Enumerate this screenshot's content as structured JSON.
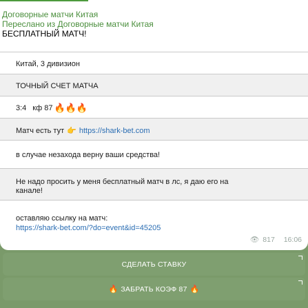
{
  "forward": {
    "channel_name": "Договорные матчи Китая",
    "forwarded_from": "Переслано из Договорные матчи Китая",
    "headline": "БЕСПЛАТНЫЙ МАТЧ!"
  },
  "rows": [
    {
      "text": "Китай, 3 дивизион"
    },
    {
      "text": "ТОЧНЫЙ СЧЕТ МАТЧА"
    },
    {
      "score": "3:4",
      "coef": "кф 87"
    },
    {
      "prefix": "Матч есть тут",
      "link": "https://shark-bet.com"
    },
    {
      "text": "в случае незахода верну ваши средства!"
    },
    {
      "line1": "Не надо просить у меня бесплатный матч в лс, я даю его на",
      "line2": "канале!"
    },
    {
      "line1": "оставляю ссылку на матч:",
      "link": "https://shark-bet.com/?do=event&id=45205"
    }
  ],
  "meta": {
    "views": "817",
    "time": "16:06"
  },
  "buttons": {
    "bet": "СДЕЛАТЬ СТАВКУ",
    "bonus": "ЗАБРАТЬ КОЭФ 87"
  },
  "icons": [
    "fire-icon",
    "pointing-hand-icon",
    "eye-icon",
    "external-link-icon"
  ]
}
